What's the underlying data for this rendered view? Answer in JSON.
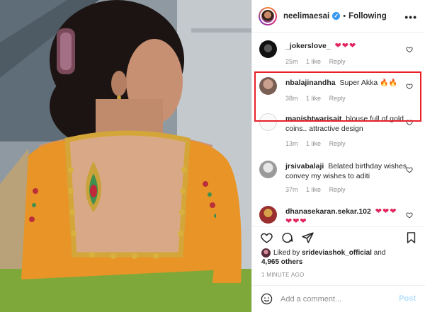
{
  "header": {
    "username": "neelimaesai",
    "dot": "•",
    "follow_status": "Following",
    "more": "•••"
  },
  "comments": [
    {
      "username": "_jokerslove_",
      "text": "",
      "hearts": "❤❤❤",
      "time": "25m",
      "likes": "1 like",
      "reply": "Reply"
    },
    {
      "username": "nbalajinandha",
      "text": "Super Akka",
      "flames": "🔥🔥",
      "time": "38m",
      "likes": "1 like",
      "reply": "Reply"
    },
    {
      "username": "manishtwarisait",
      "text": "blouse full of gold coins.. attractive design",
      "time": "13m",
      "likes": "1 like",
      "reply": "Reply"
    },
    {
      "username": "jrsivabalaji",
      "text": "Belated birthday wishes convey my wishes to aditi",
      "time": "37m",
      "likes": "1 like",
      "reply": "Reply"
    },
    {
      "username": "dhanasekaran.sekar.102",
      "hearts_line1": "❤❤❤",
      "hearts_line2": "❤❤❤"
    }
  ],
  "likes": {
    "prefix": "Liked by",
    "user": "srideviashok_official",
    "and": "and",
    "others": "4,965 others"
  },
  "time_ago": "1 MINUTE AGO",
  "add_comment": {
    "placeholder": "Add a comment...",
    "post_label": "Post"
  },
  "colors": {
    "highlight": "#e8202a",
    "heart_red": "#e0245e",
    "verified": "#3897f0",
    "post_disabled": "#b2dffc"
  },
  "icons": [
    "verified-icon",
    "heart-icon",
    "comment-icon",
    "share-icon",
    "bookmark-icon",
    "emoji-icon"
  ]
}
